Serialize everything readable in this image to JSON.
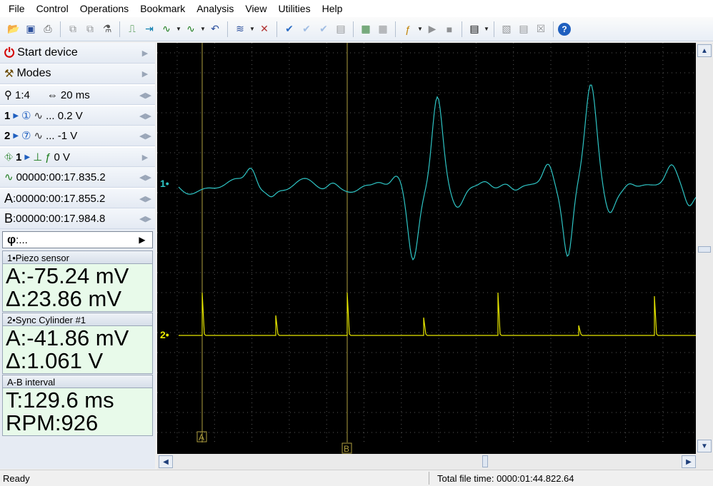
{
  "menu": [
    "File",
    "Control",
    "Operations",
    "Bookmark",
    "Analysis",
    "View",
    "Utilities",
    "Help"
  ],
  "panel": {
    "start_device": "Start device",
    "modes": "Modes",
    "zoom": "1:4",
    "timebase": "20 ms",
    "ch1_num": "1",
    "ch1_scale": "... 0.2 V",
    "ch2_num": "2",
    "ch2_scale": "... -1 V",
    "trigger_ch": "1",
    "trigger_level": "0 V",
    "trigger_time": "00000:00:17.835.2",
    "cursor_a_label": "A",
    "cursor_a_time": ":00000:00:17.855.2",
    "cursor_b_label": "B",
    "cursor_b_time": ":00000:00:17.984.8",
    "phi_label": "φ",
    "phi_value": ":..."
  },
  "measurements": {
    "ch1_title": "1•Piezo sensor",
    "ch1_a": "A:-75.24 mV",
    "ch1_delta": "Δ:23.86 mV",
    "ch2_title": "2•Sync Cylinder #1",
    "ch2_a": "A:-41.86 mV",
    "ch2_delta": "Δ:1.061 V",
    "interval_title": "A-B interval",
    "interval_t": "T:129.6 ms",
    "interval_rpm": "RPM:926"
  },
  "scope": {
    "ch1_marker": "1•",
    "ch2_marker": "2•",
    "cursor_a": "A",
    "cursor_b": "B",
    "ch1_color": "#2ec4c4",
    "ch2_color": "#e6e600",
    "cursor_color": "#b0a040"
  },
  "status": {
    "left": "Ready",
    "right": "Total file time: 0000:01:44.822.64"
  }
}
